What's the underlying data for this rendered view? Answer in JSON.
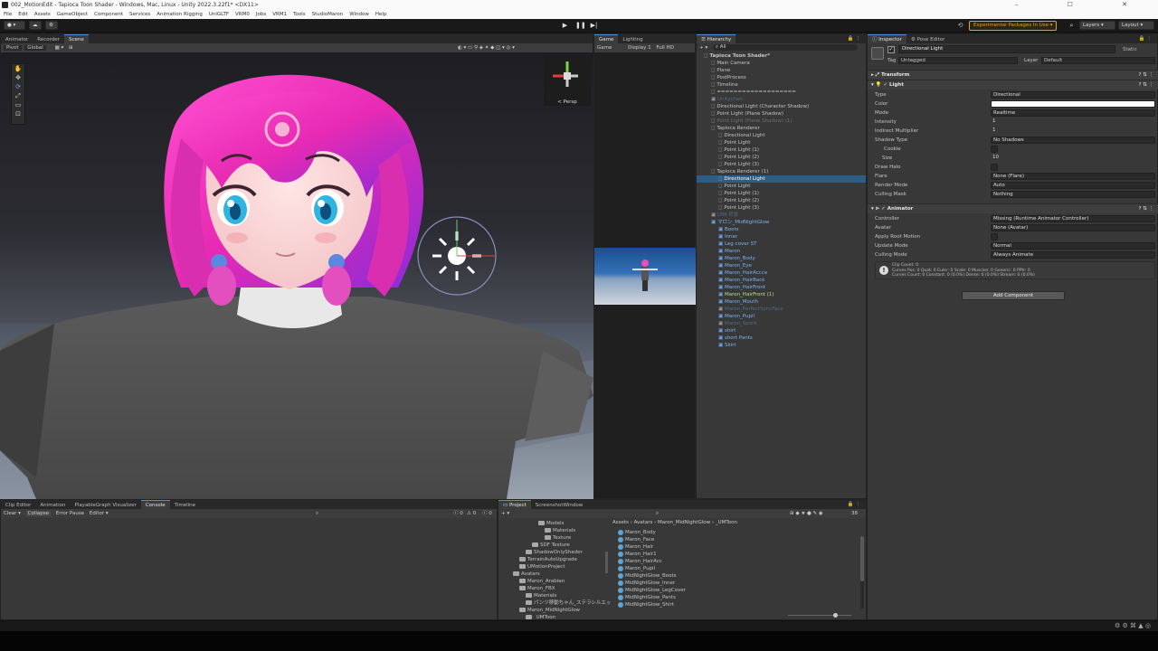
{
  "window": {
    "title": "002_MotionEdit - Tapioca Toon Shader - Windows, Mac, Linux - Unity 2022.3.22f1* <DX11>"
  },
  "menu": [
    "File",
    "Edit",
    "Assets",
    "GameObject",
    "Component",
    "Services",
    "Animation Rigging",
    "UniGLTF",
    "VRM0",
    "Jobs",
    "VRM1",
    "Tools",
    "StudioMaron",
    "Window",
    "Help"
  ],
  "toolbar": {
    "experimental": "Experimental Packages In Use ▾",
    "layers": "Layers",
    "layout": "Layout"
  },
  "scene_tabs": [
    "Animator",
    "Recorder",
    "Scene"
  ],
  "scene_toolbar": {
    "pivot": "Pivot",
    "global": "Global",
    "persp": "< Persp"
  },
  "game_tabs": [
    "Game",
    "Lighting"
  ],
  "game_toolbar": {
    "mode": "Game",
    "display": "Display 1",
    "res": "Full HD"
  },
  "hierarchy": {
    "tab": "Hierarchy",
    "search": "All",
    "rows": [
      {
        "indent": 0,
        "text": "Tapioca Toon Shader*",
        "style": "bold"
      },
      {
        "indent": 1,
        "text": "Main Camera",
        "style": ""
      },
      {
        "indent": 1,
        "text": "Plane",
        "style": ""
      },
      {
        "indent": 1,
        "text": "PostProcess",
        "style": ""
      },
      {
        "indent": 1,
        "text": "Timeline",
        "style": ""
      },
      {
        "indent": 1,
        "text": "===================",
        "style": ""
      },
      {
        "indent": 1,
        "text": "Unitychan",
        "style": "pdim"
      },
      {
        "indent": 1,
        "text": "Directional Light (Character Shadow)",
        "style": ""
      },
      {
        "indent": 1,
        "text": "Point Light (Plane Shadow)",
        "style": ""
      },
      {
        "indent": 1,
        "text": "Point Light (Plane Shadow) (1)",
        "style": "dim"
      },
      {
        "indent": 1,
        "text": "Tapioca Renderer",
        "style": ""
      },
      {
        "indent": 2,
        "text": "Directional Light",
        "style": ""
      },
      {
        "indent": 2,
        "text": "Point Light",
        "style": ""
      },
      {
        "indent": 2,
        "text": "Point Light (1)",
        "style": ""
      },
      {
        "indent": 2,
        "text": "Point Light (2)",
        "style": ""
      },
      {
        "indent": 2,
        "text": "Point Light (3)",
        "style": ""
      },
      {
        "indent": 1,
        "text": "Tapioca Renderer (1)",
        "style": ""
      },
      {
        "indent": 2,
        "text": "Directional Light",
        "style": "sel"
      },
      {
        "indent": 2,
        "text": "Point Light",
        "style": ""
      },
      {
        "indent": 2,
        "text": "Point Light (1)",
        "style": ""
      },
      {
        "indent": 2,
        "text": "Point Light (2)",
        "style": ""
      },
      {
        "indent": 2,
        "text": "Point Light (3)",
        "style": ""
      },
      {
        "indent": 1,
        "text": "UIM 背景",
        "style": "pdim"
      },
      {
        "indent": 1,
        "text": "マロン_MidNightGlow",
        "style": "pref"
      },
      {
        "indent": 2,
        "text": "Boots",
        "style": "pref"
      },
      {
        "indent": 2,
        "text": "Inner",
        "style": "pref"
      },
      {
        "indent": 2,
        "text": "Leg cover ST",
        "style": "pref"
      },
      {
        "indent": 2,
        "text": "Maron",
        "style": "pref"
      },
      {
        "indent": 2,
        "text": "Maron_Body",
        "style": "pref"
      },
      {
        "indent": 2,
        "text": "Maron_Eye",
        "style": "pref"
      },
      {
        "indent": 2,
        "text": "Maron_HairAccce",
        "style": "pref"
      },
      {
        "indent": 2,
        "text": "Maron_HairBack",
        "style": "pref"
      },
      {
        "indent": 2,
        "text": "Maron_HairFront",
        "style": "pref"
      },
      {
        "indent": 2,
        "text": "Maron_HairFront (1)",
        "style": "green"
      },
      {
        "indent": 2,
        "text": "Maron_Mouth",
        "style": "pref"
      },
      {
        "indent": 2,
        "text": "Maron_PerfectSyncFace",
        "style": "pdim"
      },
      {
        "indent": 2,
        "text": "Maron_Pupil",
        "style": "pref"
      },
      {
        "indent": 2,
        "text": "Maron_Spark",
        "style": "pdim"
      },
      {
        "indent": 2,
        "text": "shirt",
        "style": "pref"
      },
      {
        "indent": 2,
        "text": "short Pants",
        "style": "pref"
      },
      {
        "indent": 2,
        "text": "Skirt",
        "style": "pref"
      }
    ]
  },
  "inspector": {
    "tabs": [
      "Inspector",
      "Pose Editor"
    ],
    "object_name": "Directional Light",
    "static": "Static",
    "tag_label": "Tag",
    "tag": "Untagged",
    "layer_label": "Layer",
    "layer": "Default",
    "transform": "Transform",
    "light": "Light",
    "light_fields": [
      {
        "label": "Type",
        "value": "Directional"
      },
      {
        "label": "Color",
        "value": ""
      },
      {
        "label": "Mode",
        "value": "Realtime"
      },
      {
        "label": "Intensity",
        "value": "1"
      },
      {
        "label": "Indirect Multiplier",
        "value": "1"
      },
      {
        "label": "Shadow Type",
        "value": "No Shadows"
      },
      {
        "label": "Cookie",
        "value": ""
      },
      {
        "label": "Size",
        "value": "10"
      },
      {
        "label": "Draw Halo",
        "value": ""
      },
      {
        "label": "Flare",
        "value": "None (Flare)"
      },
      {
        "label": "Render Mode",
        "value": "Auto"
      },
      {
        "label": "Culling Mask",
        "value": "Nothing"
      }
    ],
    "animator": "Animator",
    "animator_fields": [
      {
        "label": "Controller",
        "value": "Missing (Runtime Animator Controller)"
      },
      {
        "label": "Avatar",
        "value": "None (Avatar)"
      },
      {
        "label": "Apply Root Motion",
        "value": ""
      },
      {
        "label": "Update Mode",
        "value": "Normal"
      },
      {
        "label": "Culling Mode",
        "value": "Always Animate"
      }
    ],
    "clip_info": [
      "Clip Count: 0",
      "Curves Pos: 0 Quat: 0 Euler: 0 Scale: 0 Muscles: 0 Generic: 0 PPtr: 0",
      "Curves Count: 0 Constant: 0 (0.0%) Dense: 0 (0.0%) Stream: 0 (0.0%)"
    ],
    "add_component": "Add Component"
  },
  "console": {
    "tabs": [
      "Clip Editor",
      "Animation",
      "PlayableGraph Visualizer",
      "Console",
      "Timeline"
    ],
    "clear": "Clear ▾",
    "collapse": "Collapse",
    "error_pause": "Error Pause",
    "editor": "Editor ▾",
    "counts": [
      "0",
      "0",
      "0"
    ]
  },
  "project": {
    "tabs": [
      "Project",
      "ScreenshotWindow"
    ],
    "count": "38",
    "tree": [
      {
        "indent": 4,
        "text": "Models"
      },
      {
        "indent": 5,
        "text": "Materials"
      },
      {
        "indent": 5,
        "text": "Texture"
      },
      {
        "indent": 3,
        "text": "SDF Texture"
      },
      {
        "indent": 2,
        "text": "ShadowOnlyShader"
      },
      {
        "indent": 1,
        "text": "TerrainAutoUpgrade"
      },
      {
        "indent": 1,
        "text": "UMotionProject"
      },
      {
        "indent": 0,
        "text": "Avatars"
      },
      {
        "indent": 1,
        "text": "Maron_Arabian"
      },
      {
        "indent": 1,
        "text": "Maron_FBX"
      },
      {
        "indent": 2,
        "text": "Materials"
      },
      {
        "indent": 2,
        "text": "パンツ移動ちゃん_ステラシルエット"
      },
      {
        "indent": 1,
        "text": "Maron_MidNightGlow"
      },
      {
        "indent": 2,
        "text": "_UMToon"
      }
    ],
    "breadcrumb": [
      "Assets",
      "Avatars",
      "Maron_MidNightGlow",
      "_UMToon"
    ],
    "assets": [
      "Maron_Body",
      "Maron_Face",
      "Maron_Hair",
      "Maron_Hair1",
      "Maron_HairAcc",
      "Maron_Pupil",
      "MidNightGlow_Boots",
      "MidNightGlow_Inner",
      "MidNightGlow_LegCover",
      "MidNightGlow_Pants",
      "MidNightGlow_Shirt"
    ]
  }
}
